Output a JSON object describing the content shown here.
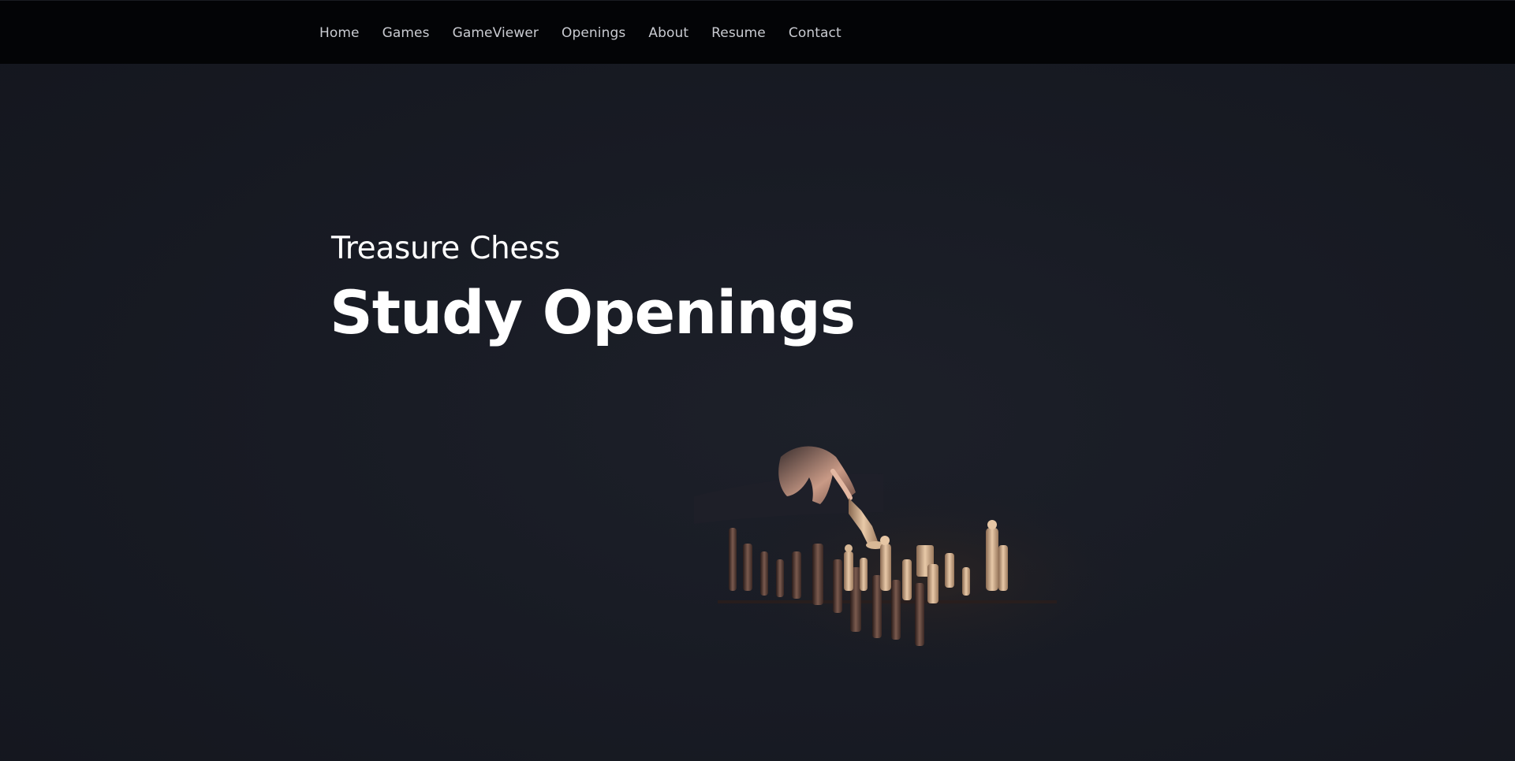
{
  "nav": {
    "items": [
      {
        "label": "Home"
      },
      {
        "label": "Games"
      },
      {
        "label": "GameViewer"
      },
      {
        "label": "Openings"
      },
      {
        "label": "About"
      },
      {
        "label": "Resume"
      },
      {
        "label": "Contact"
      }
    ]
  },
  "hero": {
    "subtitle": "Treasure Chess",
    "title": "Study Openings",
    "image": "chess-hand-moving-piece"
  },
  "colors": {
    "background": "#181b24",
    "navbar": "#030406",
    "nav_text": "#c9cbd1",
    "hero_text": "#ffffff"
  }
}
